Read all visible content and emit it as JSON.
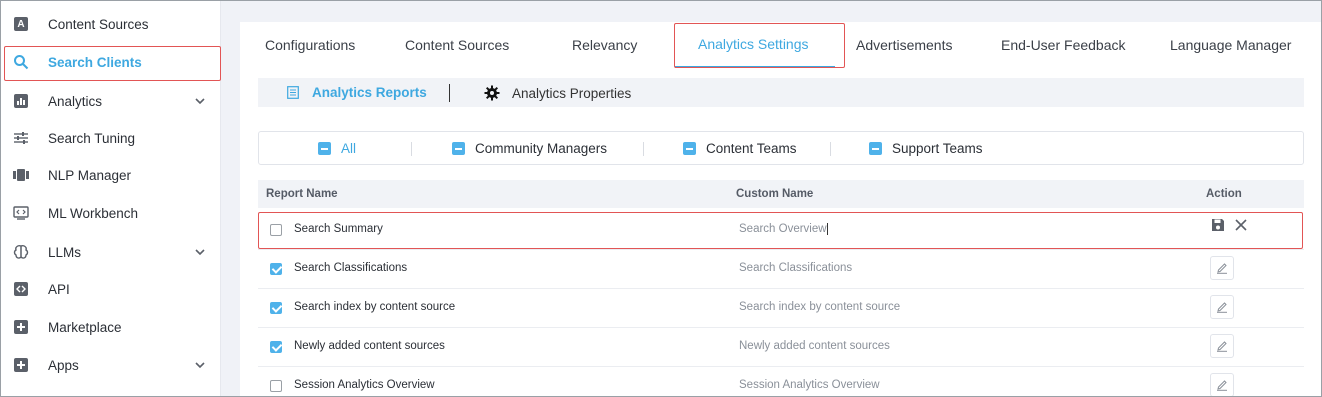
{
  "sidebar": {
    "items": [
      {
        "label": "Content Sources",
        "icon": "content-sources-icon"
      },
      {
        "label": "Search Clients",
        "icon": "search-icon",
        "active": true
      },
      {
        "label": "Analytics",
        "icon": "analytics-icon",
        "expandable": true
      },
      {
        "label": "Search Tuning",
        "icon": "sliders-icon"
      },
      {
        "label": "NLP Manager",
        "icon": "nlp-icon"
      },
      {
        "label": "ML Workbench",
        "icon": "ml-workbench-icon"
      },
      {
        "label": "LLMs",
        "icon": "brain-icon",
        "expandable": true
      },
      {
        "label": "API",
        "icon": "api-icon"
      },
      {
        "label": "Marketplace",
        "icon": "plus-box-icon"
      },
      {
        "label": "Apps",
        "icon": "plus-box-icon",
        "expandable": true
      }
    ],
    "content_sources_glyph": "A"
  },
  "tabs": [
    {
      "label": "Configurations"
    },
    {
      "label": "Content Sources"
    },
    {
      "label": "Relevancy"
    },
    {
      "label": "Analytics Settings",
      "active": true
    },
    {
      "label": "Advertisements"
    },
    {
      "label": "End-User Feedback"
    },
    {
      "label": "Language Manager"
    }
  ],
  "subtabs": [
    {
      "label": "Analytics Reports",
      "active": true
    },
    {
      "label": "Analytics Properties"
    }
  ],
  "filters": [
    {
      "label": "All"
    },
    {
      "label": "Community Managers"
    },
    {
      "label": "Content Teams"
    },
    {
      "label": "Support Teams"
    }
  ],
  "table": {
    "headers": {
      "report_name": "Report Name",
      "custom_name": "Custom Name",
      "action": "Action"
    },
    "rows": [
      {
        "report": "Search Summary",
        "custom": "Search Overview",
        "checked": false,
        "editing": true
      },
      {
        "report": "Search Classifications",
        "custom": "Search Classifications",
        "checked": true
      },
      {
        "report": "Search index by content source",
        "custom": "Search index by content source",
        "checked": true
      },
      {
        "report": "Newly added content sources",
        "custom": "Newly added content sources",
        "checked": true
      },
      {
        "report": "Session Analytics Overview",
        "custom": "Session Analytics Overview",
        "checked": false
      }
    ]
  },
  "colors": {
    "accent": "#3ea8e0",
    "highlight_border": "#e25555",
    "checkbox": "#4fb2ea"
  }
}
